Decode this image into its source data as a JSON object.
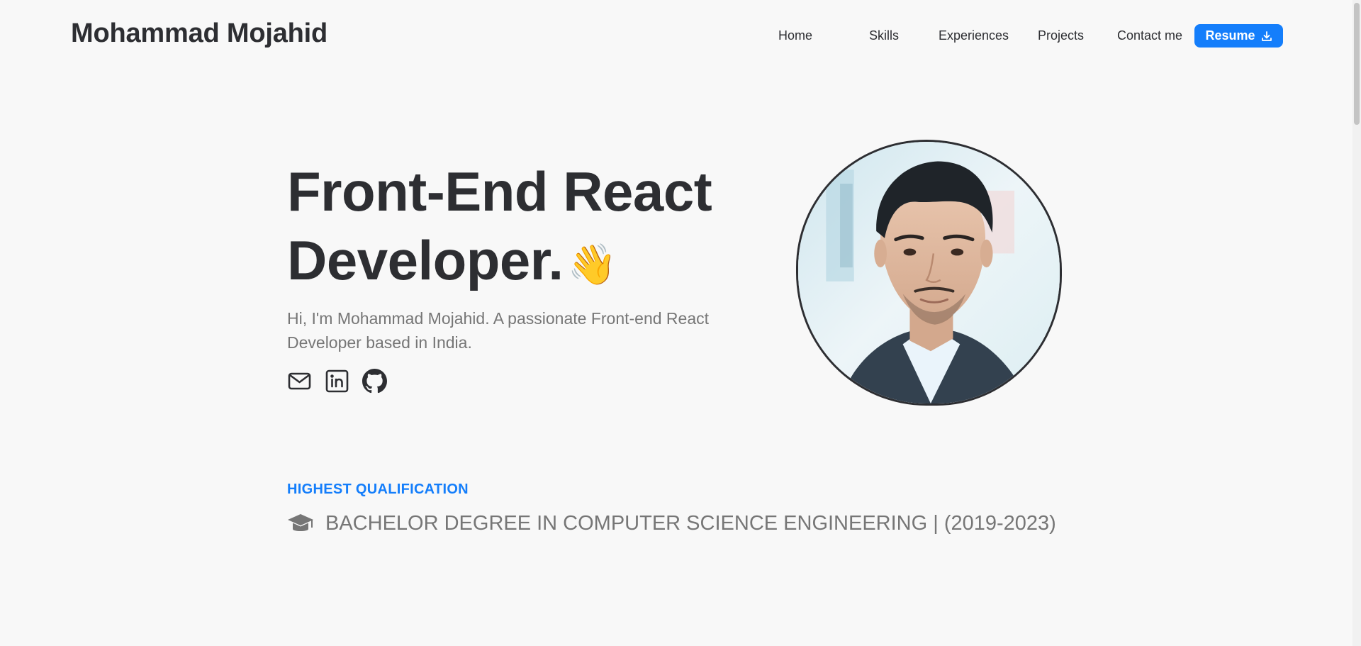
{
  "header": {
    "brand": "Mohammad Mojahid",
    "nav": [
      {
        "label": "Home"
      },
      {
        "label": "Skills"
      },
      {
        "label": "Experiences"
      },
      {
        "label": "Projects"
      },
      {
        "label": "Contact me"
      }
    ],
    "resume_label": "Resume",
    "resume_icon": "download-icon"
  },
  "hero": {
    "title_line1": "Front-End React",
    "title_line2": "Developer.",
    "wave_emoji": "👋",
    "subtitle": "Hi, I'm Mohammad Mojahid. A passionate Front-end React Developer based in India.",
    "social_icons": [
      "mail-icon",
      "linkedin-icon",
      "github-icon"
    ]
  },
  "qualification": {
    "label": "HIGHEST QUALIFICATION",
    "icon": "graduation-cap-icon",
    "text": "BACHELOR DEGREE IN COMPUTER SCIENCE ENGINEERING | (2019-2023)"
  },
  "colors": {
    "accent": "#147efb",
    "text_dark": "#2d2e32",
    "text_muted": "#767676",
    "background": "#f8f8f8"
  }
}
